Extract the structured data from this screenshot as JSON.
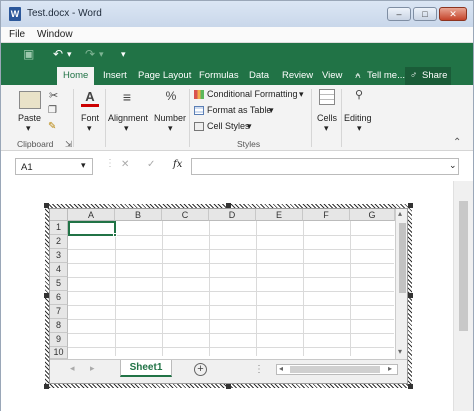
{
  "window": {
    "title": "Test.docx - Word",
    "word_icon": "W",
    "controls": {
      "minimize": "–",
      "maximize": "□",
      "close": "✕"
    }
  },
  "menubar": {
    "items": [
      "File",
      "Window"
    ]
  },
  "qat": {
    "save_icon": "▣",
    "undo_icon": "↶",
    "undo_dropdown": "▾",
    "redo_icon": "↷",
    "redo_dropdown": "▾",
    "customize_icon": "▾"
  },
  "ribbon_tabs": {
    "items": [
      "Home",
      "Insert",
      "Page Layout",
      "Formulas",
      "Data",
      "Review",
      "View"
    ],
    "active": "Home",
    "tell_me": "Tell me...",
    "tell_me_icon": "⍲",
    "share": "Share",
    "share_icon": "♂"
  },
  "ribbon": {
    "clipboard": {
      "paste": "Paste",
      "paste_arrow": "▾",
      "group": "Clipboard",
      "launcher": "⇲"
    },
    "font": {
      "label": "Font",
      "icon": "A",
      "arrow": "▾"
    },
    "alignment": {
      "label": "Alignment",
      "icon": "≡",
      "arrow": "▾"
    },
    "number": {
      "label": "Number",
      "icon": "%",
      "arrow": "▾"
    },
    "styles": {
      "conditional": "Conditional Formatting",
      "format_table": "Format as Table",
      "cell_styles": "Cell Styles",
      "dropdown": "▾",
      "group": "Styles"
    },
    "cells": {
      "label": "Cells",
      "arrow": "▾"
    },
    "editing": {
      "label": "Editing",
      "arrow": "▾"
    },
    "collapse": "⌃"
  },
  "formula_bar": {
    "name_box": "A1",
    "name_dropdown": "▾",
    "cancel": "✕",
    "enter": "✓",
    "fx": "fx",
    "value": "",
    "expand": "⌄",
    "dots": "⋮"
  },
  "sheet": {
    "columns": [
      "A",
      "B",
      "C",
      "D",
      "E",
      "F",
      "G"
    ],
    "rows": [
      "1",
      "2",
      "3",
      "4",
      "5",
      "6",
      "7",
      "8",
      "9",
      "10"
    ],
    "selected_cell": "A1",
    "tab": "Sheet1",
    "add_sheet": "+",
    "nav_prev": "◂",
    "nav_next": "▸",
    "scroll_up": "▴",
    "scroll_down": "▾"
  },
  "doc_scroll": {
    "up": "▴",
    "down": "▾"
  },
  "colors": {
    "excel_green": "#217346",
    "word_blue": "#2b579a"
  }
}
